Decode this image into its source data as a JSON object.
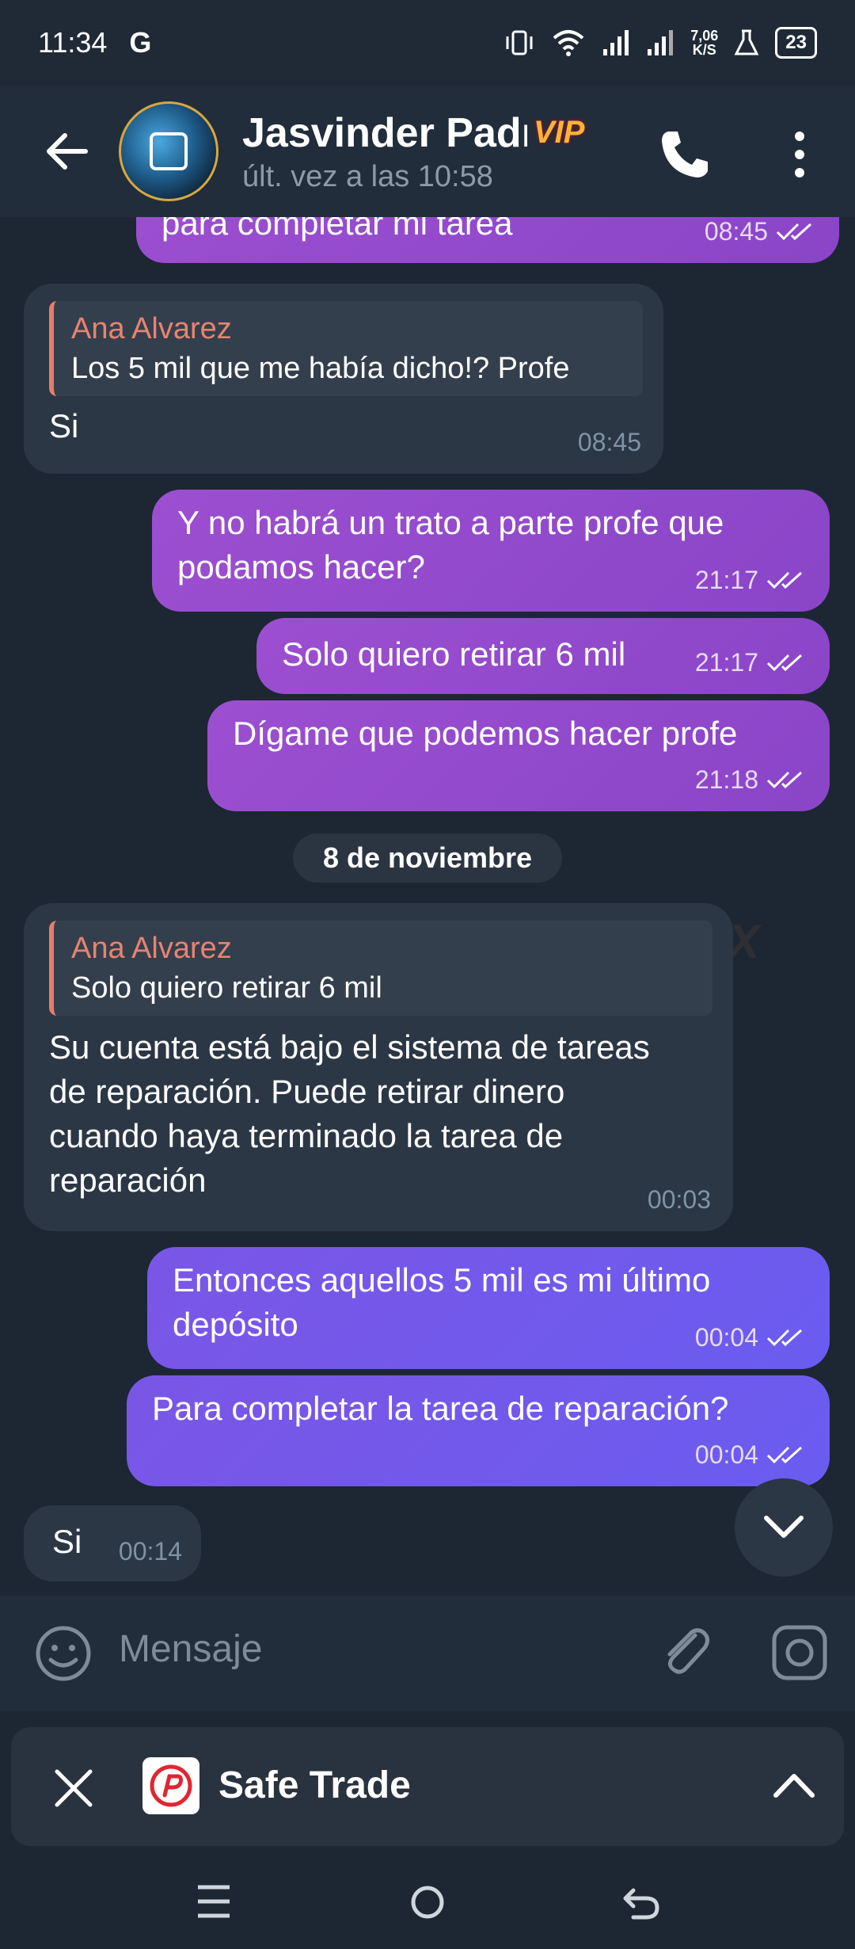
{
  "status_bar": {
    "time": "11:34",
    "carrier_icon": "G",
    "net_speed_value": "7,06",
    "net_speed_unit": "K/S",
    "battery": "23"
  },
  "header": {
    "contact_name": "Jasvinder Padı",
    "badge": "VIP",
    "last_seen": "últ. vez a las 10:58"
  },
  "messages": [
    {
      "type": "out",
      "text": "para completar mi tarea",
      "time": "08:45"
    },
    {
      "type": "in",
      "reply_name": "Ana Alvarez",
      "reply_text": "Los 5 mil que me había dicho!? Profe",
      "text": "Si",
      "time": "08:45"
    },
    {
      "type": "out",
      "text": "Y no habrá un trato a parte profe que podamos hacer?",
      "time": "21:17"
    },
    {
      "type": "out",
      "text": "Solo quiero retirar 6 mil",
      "time": "21:17"
    },
    {
      "type": "out",
      "text": "Dígame que podemos hacer profe",
      "time": "21:18"
    },
    {
      "type": "in",
      "reply_name": "Ana Alvarez",
      "reply_text": "Solo quiero retirar 6 mil",
      "text": "Su cuenta está bajo el sistema de tareas de reparación. Puede retirar dinero cuando haya terminado la tarea de reparación",
      "time": "00:03"
    },
    {
      "type": "out",
      "text": "Entonces aquellos 5 mil es mi último depósito",
      "time": "00:04"
    },
    {
      "type": "out",
      "text": "Para completar la tarea de reparación?",
      "time": "00:04"
    },
    {
      "type": "in",
      "text": "Si",
      "time": "00:14"
    }
  ],
  "date_separator": "8 de noviembre",
  "input": {
    "placeholder": "Mensaje"
  },
  "app_banner": {
    "title": "Safe Trade"
  },
  "watermark": "WikiFX",
  "colors": {
    "accent": "#9c4fd0",
    "accent2": "#6a5cf0",
    "quote": "#e8836f",
    "background": "#1c2733"
  }
}
